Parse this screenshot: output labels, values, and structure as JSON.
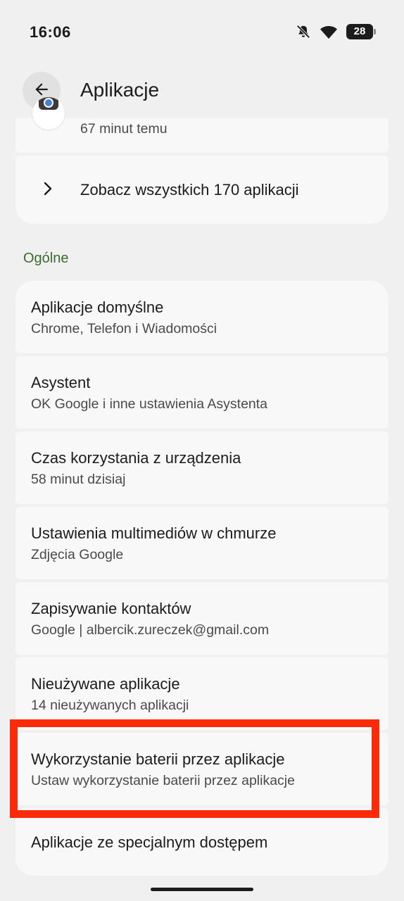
{
  "status_bar": {
    "time": "16:06",
    "battery_level": "28",
    "icons": [
      "mute-icon",
      "wifi-icon",
      "battery-icon"
    ]
  },
  "app_bar": {
    "back_icon": "arrow-left-icon",
    "title": "Aplikacje"
  },
  "recent_apps": {
    "partial_item": {
      "subtitle": "67 minut temu"
    },
    "see_all": {
      "icon": "chevron-right-icon",
      "label": "Zobacz wszystkich 170 aplikacji"
    }
  },
  "general": {
    "header": "Ogólne",
    "items": [
      {
        "title": "Aplikacje domyślne",
        "subtitle": "Chrome, Telefon i Wiadomości"
      },
      {
        "title": "Asystent",
        "subtitle": "OK Google i inne ustawienia Asystenta"
      },
      {
        "title": "Czas korzystania z urządzenia",
        "subtitle": "58 minut dzisiaj"
      },
      {
        "title": "Ustawienia multimediów w chmurze",
        "subtitle": "Zdjęcia Google"
      },
      {
        "title": "Zapisywanie kontaktów",
        "subtitle": "Google | albercik.zureczek@gmail.com"
      },
      {
        "title": "Nieużywane aplikacje",
        "subtitle": "14 nieużywanych aplikacji"
      },
      {
        "title": "Wykorzystanie baterii przez aplikacje",
        "subtitle": "Ustaw wykorzystanie baterii przez aplikacje"
      },
      {
        "title": "Aplikacje ze specjalnym dostępem"
      }
    ]
  },
  "colors": {
    "background": "#f0f0f0",
    "card": "#f8f8f8",
    "section_header": "#3e6a2b",
    "highlight": "#fb2a08"
  }
}
